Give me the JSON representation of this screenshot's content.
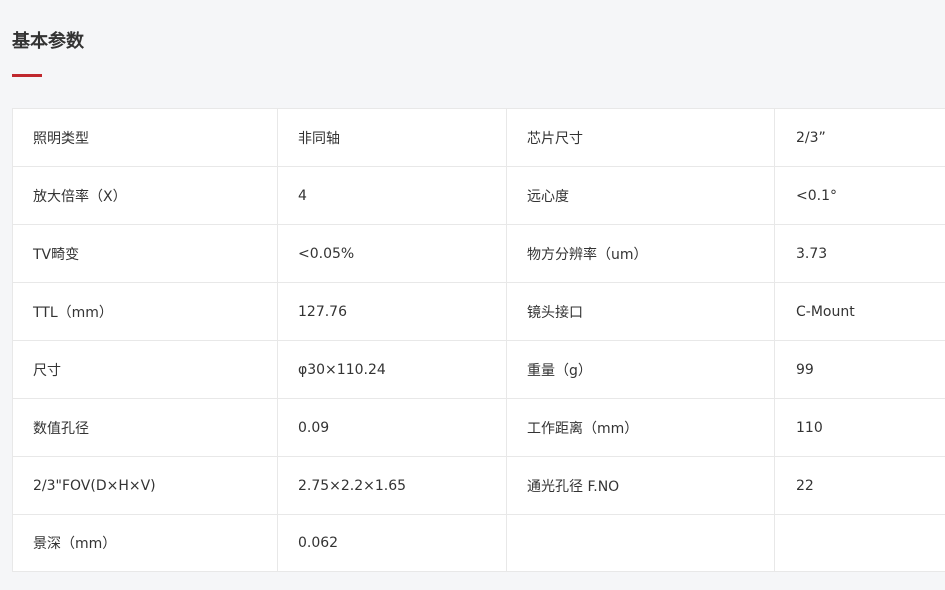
{
  "section": {
    "title": "基本参数",
    "accent_color": "#c0282e"
  },
  "rows": [
    {
      "label1": "照明类型",
      "value1": "非同轴",
      "label2": "芯片尺寸",
      "value2": "2/3”"
    },
    {
      "label1": "放大倍率（X）",
      "value1": "4",
      "label2": "远心度",
      "value2": "<0.1°"
    },
    {
      "label1": "TV畸变",
      "value1": "<0.05%",
      "label2": "物方分辨率（um）",
      "value2": "3.73"
    },
    {
      "label1": "TTL（mm）",
      "value1": "127.76",
      "label2": "镜头接口",
      "value2": "C-Mount"
    },
    {
      "label1": "尺寸",
      "value1": "φ30×110.24",
      "label2": "重量（g）",
      "value2": "99"
    },
    {
      "label1": "数值孔径",
      "value1": "0.09",
      "label2": "工作距离（mm）",
      "value2": "110"
    },
    {
      "label1": "2/3\"FOV(D×H×V)",
      "value1": "2.75×2.2×1.65",
      "label2": "通光孔径 F.NO",
      "value2": "22"
    },
    {
      "label1": "景深（mm）",
      "value1": "0.062",
      "label2": "",
      "value2": ""
    }
  ]
}
